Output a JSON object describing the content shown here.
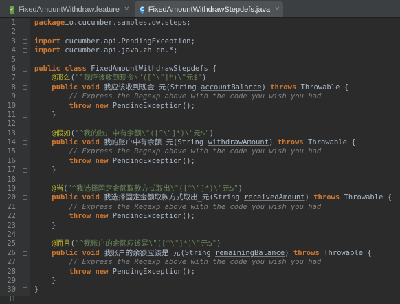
{
  "tabs": [
    {
      "label": "FixedAmountWithdraw.feature",
      "icon": "feature-file-icon",
      "active": false
    },
    {
      "label": "FixedAmountWithdrawStepdefs.java",
      "icon": "java-class-icon",
      "active": true
    }
  ],
  "code_lines": [
    {
      "n": "1",
      "fold": false,
      "parts": [
        [
          "kw",
          "package"
        ],
        [
          "",
          "io.cucumber.samples.dw.steps;"
        ]
      ]
    },
    {
      "n": "2",
      "fold": false,
      "parts": []
    },
    {
      "n": "3",
      "fold": true,
      "parts": [
        [
          "kw",
          "import"
        ],
        [
          "",
          " cucumber.api.PendingException;"
        ]
      ]
    },
    {
      "n": "4",
      "fold": true,
      "parts": [
        [
          "kw",
          "import"
        ],
        [
          "",
          " cucumber.api.java.zh_cn.*;"
        ]
      ]
    },
    {
      "n": "5",
      "fold": false,
      "parts": []
    },
    {
      "n": "6",
      "fold": true,
      "parts": [
        [
          "kw",
          "public class"
        ],
        [
          "",
          " FixedAmountWithdrawStepdefs {"
        ]
      ]
    },
    {
      "n": "7",
      "fold": false,
      "parts": [
        [
          "",
          "    "
        ],
        [
          "ann",
          "@那么"
        ],
        [
          "",
          "("
        ],
        [
          "st",
          "\"^我应该收到现金\\\"([^\\\"]*)\\\"元$\""
        ],
        [
          "",
          ")"
        ]
      ]
    },
    {
      "n": "8",
      "fold": true,
      "parts": [
        [
          "",
          "    "
        ],
        [
          "kw",
          "public void"
        ],
        [
          "",
          " 我应该收到现金_元(String "
        ],
        [
          "var",
          "accountBalance"
        ],
        [
          "",
          ") "
        ],
        [
          "kw",
          "throws"
        ],
        [
          "",
          " Throwable {"
        ]
      ]
    },
    {
      "n": "9",
      "fold": false,
      "parts": [
        [
          "cm",
          "        // Express the Regexp above with the code you wish you had"
        ]
      ]
    },
    {
      "n": "10",
      "fold": false,
      "parts": [
        [
          "",
          "        "
        ],
        [
          "kw",
          "throw new"
        ],
        [
          "",
          " PendingException();"
        ]
      ]
    },
    {
      "n": "11",
      "fold": true,
      "parts": [
        [
          "",
          "    }"
        ]
      ]
    },
    {
      "n": "12",
      "fold": false,
      "parts": []
    },
    {
      "n": "13",
      "fold": false,
      "parts": [
        [
          "",
          "    "
        ],
        [
          "ann",
          "@假如"
        ],
        [
          "",
          "("
        ],
        [
          "st",
          "\"^我的账户中有余额\\\"([^\\\"]*)\\\"元$\""
        ],
        [
          "",
          ")"
        ]
      ]
    },
    {
      "n": "14",
      "fold": true,
      "parts": [
        [
          "",
          "    "
        ],
        [
          "kw",
          "public void"
        ],
        [
          "",
          " 我的账户中有余额_元(String "
        ],
        [
          "var",
          "withdrawAmount"
        ],
        [
          "",
          ") "
        ],
        [
          "kw",
          "throws"
        ],
        [
          "",
          " Throwable {"
        ]
      ]
    },
    {
      "n": "15",
      "fold": false,
      "parts": [
        [
          "cm",
          "        // Express the Regexp above with the code you wish you had"
        ]
      ]
    },
    {
      "n": "16",
      "fold": false,
      "parts": [
        [
          "",
          "        "
        ],
        [
          "kw",
          "throw new"
        ],
        [
          "",
          " PendingException();"
        ]
      ]
    },
    {
      "n": "17",
      "fold": true,
      "parts": [
        [
          "",
          "    }"
        ]
      ]
    },
    {
      "n": "18",
      "fold": false,
      "parts": []
    },
    {
      "n": "19",
      "fold": false,
      "parts": [
        [
          "",
          "    "
        ],
        [
          "ann",
          "@当"
        ],
        [
          "",
          "("
        ],
        [
          "st",
          "\"^我选择固定金额取款方式取出\\\"([^\\\"]*)\\\"元$\""
        ],
        [
          "",
          ")"
        ]
      ]
    },
    {
      "n": "20",
      "fold": true,
      "parts": [
        [
          "",
          "    "
        ],
        [
          "kw",
          "public void"
        ],
        [
          "",
          " 我选择固定金额取款方式取出_元(String "
        ],
        [
          "var",
          "receivedAmount"
        ],
        [
          "",
          ") "
        ],
        [
          "kw",
          "throws"
        ],
        [
          "",
          " Throwable {"
        ]
      ]
    },
    {
      "n": "21",
      "fold": false,
      "parts": [
        [
          "cm",
          "        // Express the Regexp above with the code you wish you had"
        ]
      ]
    },
    {
      "n": "22",
      "fold": false,
      "parts": [
        [
          "",
          "        "
        ],
        [
          "kw",
          "throw new"
        ],
        [
          "",
          " PendingException();"
        ]
      ]
    },
    {
      "n": "23",
      "fold": true,
      "parts": [
        [
          "",
          "    }"
        ]
      ]
    },
    {
      "n": "24",
      "fold": false,
      "parts": []
    },
    {
      "n": "25",
      "fold": false,
      "parts": [
        [
          "",
          "    "
        ],
        [
          "ann",
          "@而且"
        ],
        [
          "",
          "("
        ],
        [
          "st",
          "\"^我账户的余额应该是\\\"([^\\\"]*)\\\"元$\""
        ],
        [
          "",
          ")"
        ]
      ]
    },
    {
      "n": "26",
      "fold": true,
      "parts": [
        [
          "",
          "    "
        ],
        [
          "kw",
          "public void"
        ],
        [
          "",
          " 我账户的余额应该是_元(String "
        ],
        [
          "var",
          "remainingBalance"
        ],
        [
          "",
          ") "
        ],
        [
          "kw",
          "throws"
        ],
        [
          "",
          " Throwable {"
        ]
      ]
    },
    {
      "n": "27",
      "fold": false,
      "parts": [
        [
          "cm",
          "        // Express the Regexp above with the code you wish you had"
        ]
      ]
    },
    {
      "n": "28",
      "fold": false,
      "parts": [
        [
          "",
          "        "
        ],
        [
          "kw",
          "throw new"
        ],
        [
          "",
          " PendingException();"
        ]
      ]
    },
    {
      "n": "29",
      "fold": true,
      "parts": [
        [
          "",
          "    }"
        ]
      ]
    },
    {
      "n": "30",
      "fold": true,
      "parts": [
        [
          "",
          "}"
        ]
      ]
    },
    {
      "n": "31",
      "fold": false,
      "parts": []
    }
  ],
  "colors": {
    "keyword": "#cc7832",
    "string": "#6a8759",
    "comment": "#808080",
    "annotation": "#bbb529",
    "text": "#a9b7c6",
    "background": "#2b2b2b"
  }
}
